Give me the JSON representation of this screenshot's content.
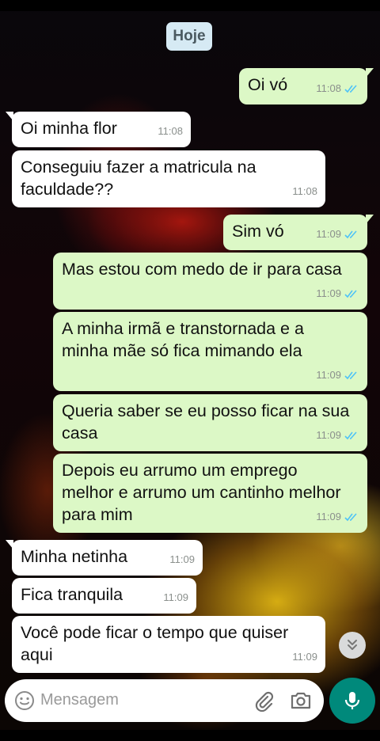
{
  "date_chip": "Hoje",
  "messages": [
    {
      "dir": "out",
      "text": "Oi vó",
      "time": "11:08",
      "status": "read"
    },
    {
      "dir": "in",
      "text": "Oi minha flor",
      "time": "11:08"
    },
    {
      "dir": "in",
      "text": "Conseguiu fazer a matricula na faculdade??",
      "time": "11:08"
    },
    {
      "dir": "out",
      "text": "Sim vó",
      "time": "11:09",
      "status": "read"
    },
    {
      "dir": "out",
      "text": "Mas estou com medo de ir para casa",
      "time": "11:09",
      "status": "read"
    },
    {
      "dir": "out",
      "text": "A minha irmã e transtornada e a minha mãe só fica mimando ela",
      "time": "11:09",
      "status": "read"
    },
    {
      "dir": "out",
      "text": "Queria saber se eu posso ficar na sua casa",
      "time": "11:09",
      "status": "read"
    },
    {
      "dir": "out",
      "text": "Depois eu arrumo um emprego melhor e arrumo um cantinho melhor para mim",
      "time": "11:09",
      "status": "read"
    },
    {
      "dir": "in",
      "text": "Minha netinha",
      "time": "11:09"
    },
    {
      "dir": "in",
      "text": "Fica tranquila",
      "time": "11:09"
    },
    {
      "dir": "in",
      "text": "Você pode ficar o tempo que quiser aqui",
      "time": "11:09"
    }
  ],
  "composer": {
    "placeholder": "Mensagem",
    "emoji_icon": "emoji-icon",
    "attach_icon": "paperclip-icon",
    "camera_icon": "camera-icon",
    "mic_icon": "mic-icon"
  },
  "scroll_down_icon": "double-chevron-down-icon",
  "colors": {
    "incoming_bubble": "#ffffff",
    "outgoing_bubble": "#dcf8c6",
    "read_ticks": "#4fc3f7",
    "mic_button": "#00897b",
    "date_chip": "#d6eaf4"
  }
}
